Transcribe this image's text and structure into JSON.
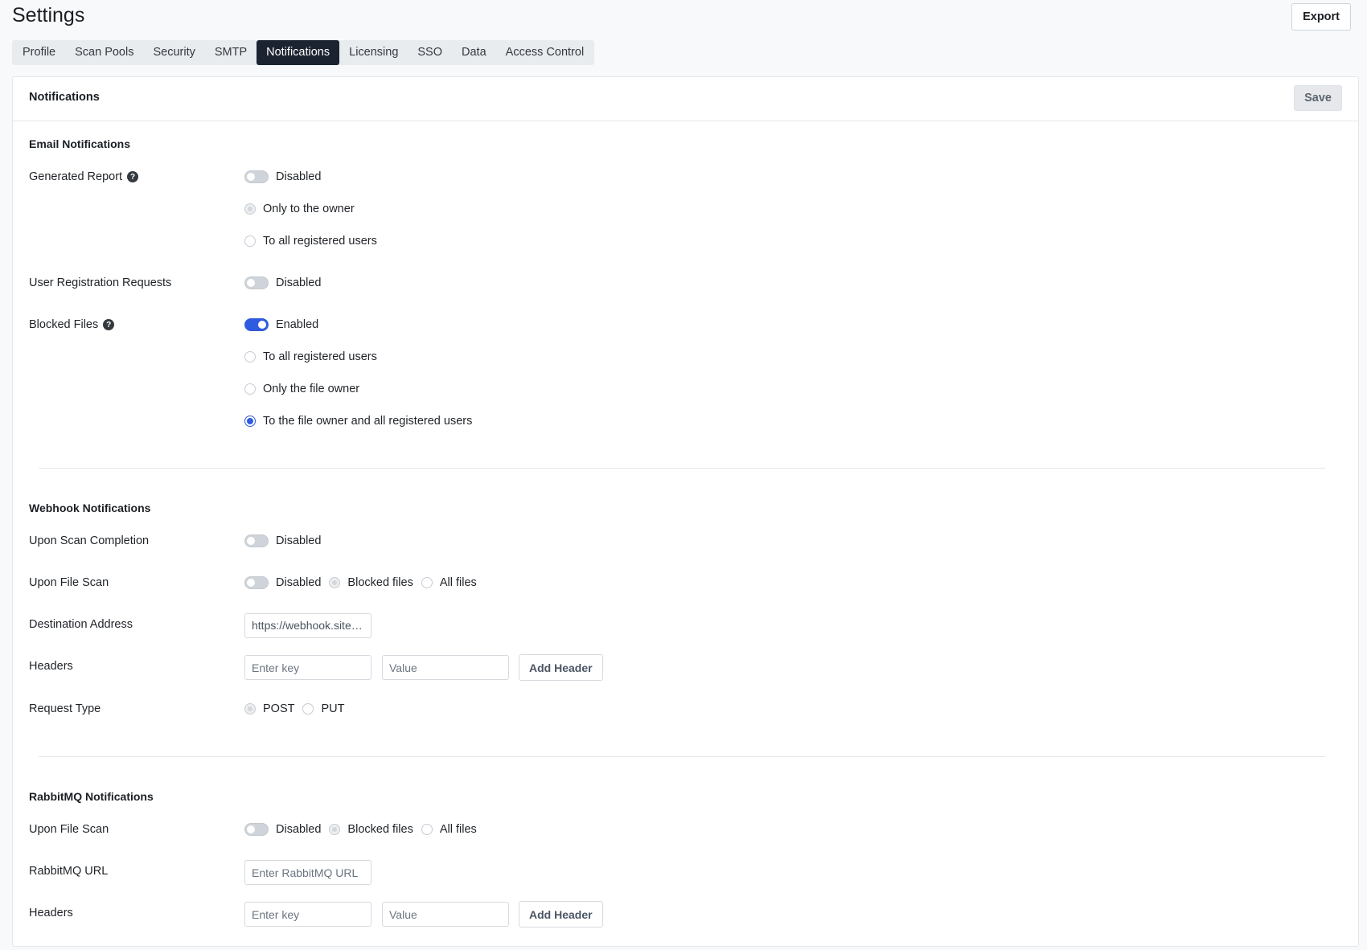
{
  "page": {
    "title": "Settings",
    "export_label": "Export"
  },
  "tabs": [
    {
      "label": "Profile"
    },
    {
      "label": "Scan Pools"
    },
    {
      "label": "Security"
    },
    {
      "label": "SMTP"
    },
    {
      "label": "Notifications",
      "active": true
    },
    {
      "label": "Licensing"
    },
    {
      "label": "SSO"
    },
    {
      "label": "Data"
    },
    {
      "label": "Access Control"
    }
  ],
  "card": {
    "title": "Notifications",
    "save_label": "Save"
  },
  "email": {
    "title": "Email Notifications",
    "generated_report": {
      "label": "Generated Report",
      "toggle": "Disabled",
      "options": [
        "Only to the owner",
        "To all registered users"
      ]
    },
    "user_registration": {
      "label": "User Registration Requests",
      "toggle": "Disabled"
    },
    "blocked_files": {
      "label": "Blocked Files",
      "toggle": "Enabled",
      "options": [
        "To all registered users",
        "Only the file owner",
        "To the file owner and all registered users"
      ],
      "selected": "To the file owner and all registered users"
    }
  },
  "webhook": {
    "title": "Webhook Notifications",
    "scan_completion": {
      "label": "Upon Scan Completion",
      "toggle": "Disabled"
    },
    "file_scan": {
      "label": "Upon File Scan",
      "toggle": "Disabled",
      "options": [
        "Blocked files",
        "All files"
      ]
    },
    "destination": {
      "label": "Destination Address",
      "value": "https://webhook.site/…"
    },
    "headers": {
      "label": "Headers",
      "key_placeholder": "Enter key",
      "value_placeholder": "Value",
      "add_label": "Add Header"
    },
    "request_type": {
      "label": "Request Type",
      "options": [
        "POST",
        "PUT"
      ]
    }
  },
  "rabbitmq": {
    "title": "RabbitMQ Notifications",
    "file_scan": {
      "label": "Upon File Scan",
      "toggle": "Disabled",
      "options": [
        "Blocked files",
        "All files"
      ]
    },
    "url": {
      "label": "RabbitMQ URL",
      "placeholder": "Enter RabbitMQ URL"
    },
    "headers": {
      "label": "Headers",
      "key_placeholder": "Enter key",
      "value_placeholder": "Value",
      "add_label": "Add Header"
    }
  }
}
